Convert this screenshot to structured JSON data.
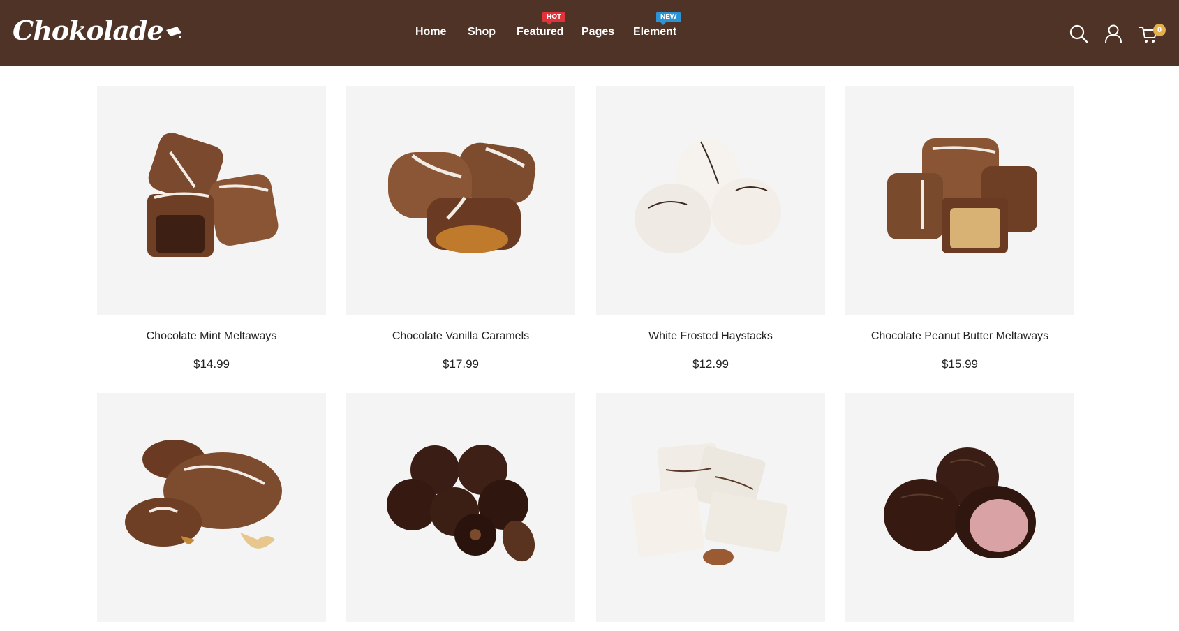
{
  "header": {
    "logo_text": "Chokolade",
    "nav": [
      {
        "label": "Home"
      },
      {
        "label": "Shop"
      },
      {
        "label": "Featured",
        "badge": "HOT",
        "badge_color": "#e2333b"
      },
      {
        "label": "Pages"
      },
      {
        "label": "Element",
        "badge": "NEW",
        "badge_color": "#2b93d6"
      }
    ],
    "icons": [
      "search-icon",
      "user-icon",
      "cart-icon"
    ],
    "cart_count": "0"
  },
  "colors": {
    "header_bg": "#4f3327",
    "card_bg": "#f4f4f4",
    "cart_badge": "#e3b04b"
  },
  "products": [
    {
      "name": "Chocolate Mint Meltaways",
      "price": "$14.99",
      "image": "milk-chocolate-meltaways"
    },
    {
      "name": "Chocolate Vanilla Caramels",
      "price": "$17.99",
      "image": "milk-chocolate-caramels"
    },
    {
      "name": "White Frosted Haystacks",
      "price": "$12.99",
      "image": "white-coconut-haystacks"
    },
    {
      "name": "Chocolate Peanut Butter Meltaways",
      "price": "$15.99",
      "image": "peanut-butter-meltaways"
    },
    {
      "image": "milk-chocolate-cashew-turtles"
    },
    {
      "image": "dark-chocolate-espresso-beans"
    },
    {
      "image": "white-almond-bark"
    },
    {
      "image": "dark-chocolate-raspberry-creams"
    }
  ]
}
